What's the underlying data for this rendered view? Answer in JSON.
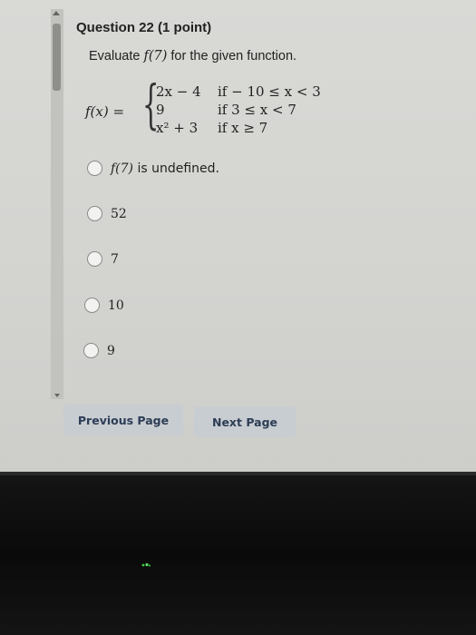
{
  "question": {
    "title": "Question 22 (1 point)",
    "prompt_pre": "Evaluate ",
    "prompt_fx": "f(7)",
    "prompt_post": " for the given function."
  },
  "function": {
    "lhs": "f(x) =",
    "rows": [
      {
        "expr": "2x − 4",
        "cond": "if  − 10 ≤ x < 3"
      },
      {
        "expr": "9",
        "cond": "if  3 ≤ x < 7"
      },
      {
        "expr": "x² + 3",
        "cond": "if  x ≥ 7"
      }
    ]
  },
  "options": [
    {
      "fx": "f(7)",
      "text": " is undefined."
    },
    {
      "text": "52"
    },
    {
      "text": "7"
    },
    {
      "text": "10"
    },
    {
      "text": "9"
    }
  ],
  "buttons": {
    "previous": "Previous Page",
    "next": "Next Page"
  },
  "colors": {
    "page_background": "#d6d6d3",
    "button_background": "#c8cdd2",
    "button_text": "#2d3d55",
    "bezel": "#111111",
    "indicator_light": "#3fcf4a"
  }
}
